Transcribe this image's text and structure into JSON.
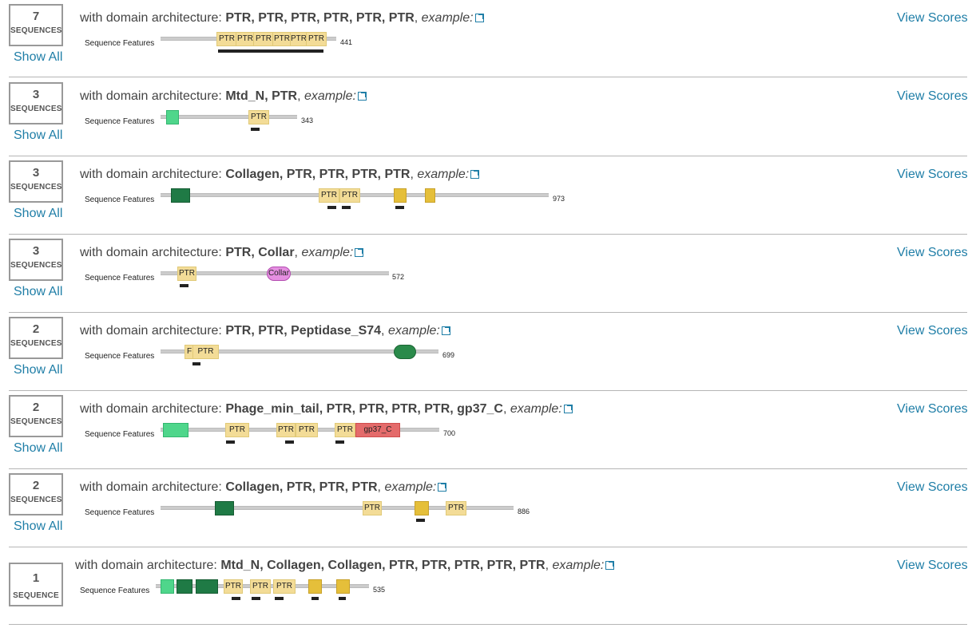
{
  "common": {
    "arch_prefix": "with domain architecture: ",
    "example_label": "example:",
    "features_label": "Sequence Features",
    "view_scores": "View Scores",
    "show_all": "Show All",
    "seq_plural": "SEQUENCES",
    "seq_singular": "SEQUENCE"
  },
  "rows": [
    {
      "count": "7",
      "unit": "SEQUENCES",
      "show_all": true,
      "arch": "PTR, PTR, PTR, PTR, PTR, PTR",
      "length": "441",
      "domain_labels": [
        "PTR",
        "PTR",
        "PTR",
        "PTR",
        "PTR",
        "PTR"
      ]
    },
    {
      "count": "3",
      "unit": "SEQUENCES",
      "show_all": true,
      "arch": "Mtd_N, PTR",
      "length": "343",
      "domain_labels": [
        "",
        "PTR"
      ]
    },
    {
      "count": "3",
      "unit": "SEQUENCES",
      "show_all": true,
      "arch": "Collagen, PTR, PTR, PTR, PTR",
      "length": "973",
      "domain_labels": [
        "",
        "PTR",
        "PTR",
        "",
        ""
      ]
    },
    {
      "count": "3",
      "unit": "SEQUENCES",
      "show_all": true,
      "arch": "PTR, Collar",
      "length": "572",
      "domain_labels": [
        "PTR",
        "Collar"
      ]
    },
    {
      "count": "2",
      "unit": "SEQUENCES",
      "show_all": true,
      "arch": "PTR, PTR, Peptidase_S74",
      "length": "699",
      "domain_labels": [
        "F",
        "PTR",
        ""
      ]
    },
    {
      "count": "2",
      "unit": "SEQUENCES",
      "show_all": true,
      "arch": "Phage_min_tail, PTR, PTR, PTR, PTR, gp37_C",
      "length": "700",
      "domain_labels": [
        "",
        "PTR",
        "PTR",
        "PTR",
        "PTR",
        "gp37_C"
      ]
    },
    {
      "count": "2",
      "unit": "SEQUENCES",
      "show_all": true,
      "arch": "Collagen, PTR, PTR, PTR",
      "length": "886",
      "domain_labels": [
        "",
        "PTR",
        "",
        "PTR"
      ]
    },
    {
      "count": "1",
      "unit": "SEQUENCE",
      "show_all": false,
      "arch": "Mtd_N, Collagen, Collagen, PTR, PTR, PTR, PTR, PTR",
      "length": "535",
      "domain_labels": [
        "",
        "",
        "",
        "PTR",
        "PTR",
        "PTR",
        "",
        ""
      ]
    }
  ]
}
